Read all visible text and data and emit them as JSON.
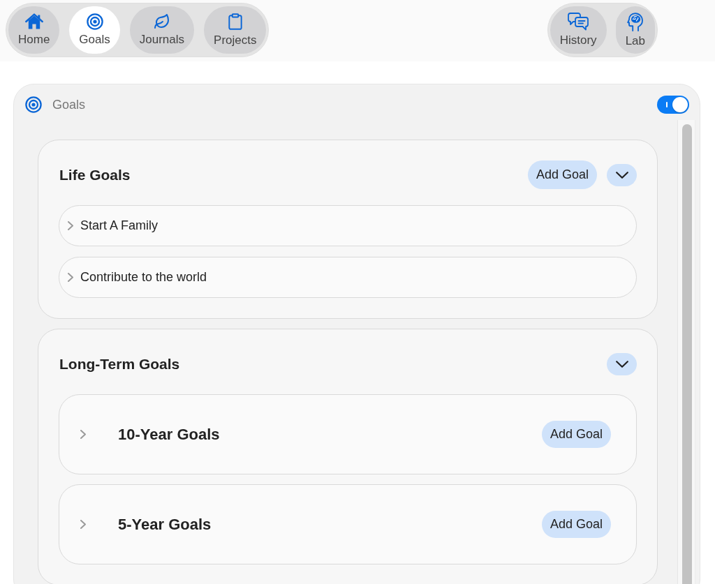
{
  "nav": {
    "left": [
      {
        "label": "Home",
        "selected": false
      },
      {
        "label": "Goals",
        "selected": true
      },
      {
        "label": "Journals",
        "selected": false
      },
      {
        "label": "Projects",
        "selected": false
      }
    ],
    "right": [
      {
        "label": "History",
        "selected": false
      },
      {
        "label": "Lab",
        "selected": false
      }
    ]
  },
  "panel": {
    "title": "Goals",
    "toggle": {
      "on": true
    }
  },
  "sections": [
    {
      "title": "Life Goals",
      "add_button": "Add Goal",
      "expanded": true,
      "items": [
        {
          "kind": "goal",
          "label": "Start A Family",
          "expanded": false
        },
        {
          "kind": "goal",
          "label": "Contribute to the world",
          "expanded": false
        }
      ]
    },
    {
      "title": "Long-Term Goals",
      "expanded": true,
      "items": [
        {
          "kind": "group",
          "label": "10-Year Goals",
          "add_button": "Add Goal",
          "expanded": false
        },
        {
          "kind": "group",
          "label": "5-Year Goals",
          "add_button": "Add Goal",
          "expanded": false
        }
      ]
    }
  ]
}
